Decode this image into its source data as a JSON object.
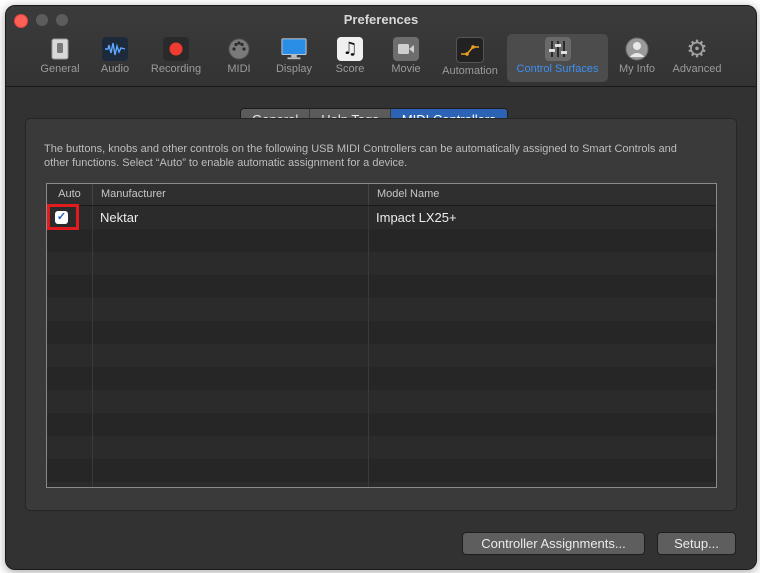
{
  "window": {
    "title": "Preferences"
  },
  "toolbar": {
    "items": [
      {
        "label": "General",
        "icon": "general-icon"
      },
      {
        "label": "Audio",
        "icon": "audio-icon"
      },
      {
        "label": "Recording",
        "icon": "recording-icon"
      },
      {
        "label": "MIDI",
        "icon": "midi-icon"
      },
      {
        "label": "Display",
        "icon": "display-icon"
      },
      {
        "label": "Score",
        "icon": "score-icon"
      },
      {
        "label": "Movie",
        "icon": "movie-icon"
      },
      {
        "label": "Automation",
        "icon": "automation-icon"
      },
      {
        "label": "Control Surfaces",
        "icon": "control-surfaces-icon",
        "selected": true
      },
      {
        "label": "My Info",
        "icon": "my-info-icon"
      },
      {
        "label": "Advanced",
        "icon": "advanced-icon"
      }
    ]
  },
  "tabs": [
    {
      "label": "General"
    },
    {
      "label": "Help Tags"
    },
    {
      "label": "MIDI Controllers",
      "active": true
    }
  ],
  "description": "The buttons, knobs and other controls on the following USB MIDI Controllers can be automatically assigned to Smart Controls and other functions. Select “Auto” to enable automatic assignment for a device.",
  "table": {
    "columns": {
      "auto": "Auto",
      "manufacturer": "Manufacturer",
      "model": "Model Name"
    },
    "rows": [
      {
        "auto": true,
        "manufacturer": "Nektar",
        "model": "Impact LX25+"
      }
    ]
  },
  "buttons": {
    "controller_assignments": "Controller Assignments...",
    "setup": "Setup..."
  },
  "colors": {
    "accent": "#3d8ff5",
    "segment_active": "#2d63b5",
    "highlight": "#e21c1c",
    "close": "#fe5f57"
  }
}
